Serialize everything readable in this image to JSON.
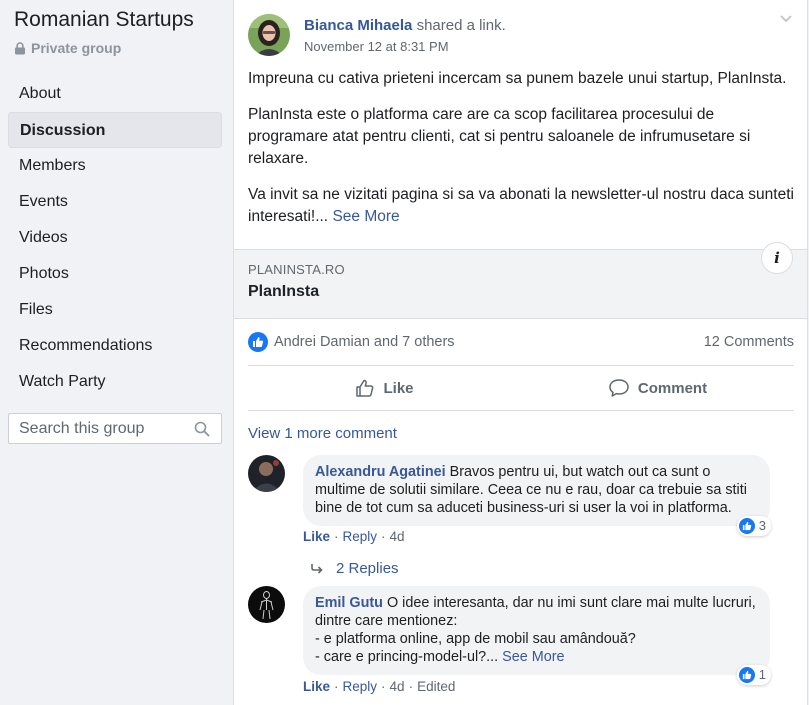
{
  "group": {
    "title": "Romanian Startups",
    "privacy": "Private group"
  },
  "nav": {
    "items": [
      {
        "label": "About"
      },
      {
        "label": "Discussion"
      },
      {
        "label": "Members"
      },
      {
        "label": "Events"
      },
      {
        "label": "Videos"
      },
      {
        "label": "Photos"
      },
      {
        "label": "Files"
      },
      {
        "label": "Recommendations"
      },
      {
        "label": "Watch Party"
      }
    ]
  },
  "search": {
    "placeholder": "Search this group",
    "value": ""
  },
  "post": {
    "author": "Bianca Mihaela",
    "action": "shared a link.",
    "time": "November 12 at 8:31 PM",
    "paragraphs": [
      "Impreuna cu cativa prieteni incercam sa punem bazele unui startup, PlanInsta.",
      "PlanInsta este o platforma care are ca scop facilitarea procesului de programare atat pentru clienti, cat si pentru saloanele de infrumusetare si relaxare.",
      "Va invit sa ne vizitati pagina si sa va abonati la newsletter-ul nostru daca sunteti interesati!..."
    ],
    "see_more": "See More",
    "link": {
      "domain": "PLANINSTA.RO",
      "title": "PlanInsta",
      "info_glyph": "i"
    },
    "reactions": {
      "names": "Andrei Damian and 7 others",
      "comments": "12 Comments"
    },
    "actions": {
      "like": "Like",
      "comment": "Comment"
    },
    "view_more_comments": "View 1 more comment"
  },
  "comments": [
    {
      "author": "Alexandru Agatinei",
      "text": "Bravos pentru ui, but watch out ca sunt o multime de solutii similare. Ceea ce nu e rau, doar ca trebuie sa stiti bine de tot cum sa aduceti business-uri si user la voi in platforma.",
      "like": "Like",
      "reply": "Reply",
      "time": "4d",
      "reaction_count": "3",
      "replies": "2 Replies"
    },
    {
      "author": "Emil Gutu",
      "text_lines": [
        "O idee interesanta, dar nu imi sunt clare mai multe lucruri, dintre care mentionez:",
        "- e platforma online, app de mobil sau amândouă?",
        "- care e princing-model-ul?..."
      ],
      "see_more": "See More",
      "like": "Like",
      "reply": "Reply",
      "time": "4d",
      "edited": "Edited",
      "reaction_count": "1"
    }
  ],
  "colors": {
    "link_blue": "#365899",
    "like_blue": "#1877f2",
    "page_bg": "#f0f2f5"
  }
}
